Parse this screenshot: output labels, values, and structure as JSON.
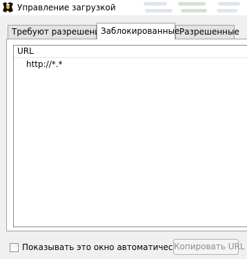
{
  "window": {
    "title": "Управление загрузкой"
  },
  "tabs": [
    {
      "label": "Требуют разрешения",
      "active": false
    },
    {
      "label": "Заблокированные",
      "active": true
    },
    {
      "label": "Разрешенные",
      "active": false
    }
  ],
  "list": {
    "columns": [
      "URL"
    ],
    "rows": [
      {
        "url": "http://*.*"
      }
    ]
  },
  "footer": {
    "auto_show_checkbox": {
      "label": "Показывать это окно автоматически",
      "checked": false
    },
    "copy_url_button": {
      "label": "Копировать URL",
      "enabled": false
    }
  }
}
